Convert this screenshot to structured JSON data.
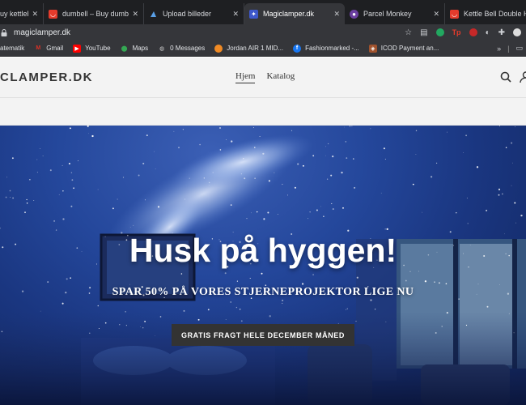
{
  "browser": {
    "tabs": [
      {
        "title": "uy kettleb",
        "favicon": "aliexpress-icon",
        "color": "#e53b2c"
      },
      {
        "title": "dumbell – Buy dumbell",
        "favicon": "aliexpress-icon",
        "color": "#e53b2c"
      },
      {
        "title": "Upload billeder",
        "favicon": "upload-icon",
        "color": "#5aa0e8"
      },
      {
        "title": "Magiclamper.dk",
        "favicon": "magiclamper-icon",
        "color": "#3d57c9"
      },
      {
        "title": "Parcel Monkey",
        "favicon": "monkey-icon",
        "color": "#6b3fa0"
      },
      {
        "title": "Kettle Bell Double Hand",
        "favicon": "aliexpress-icon",
        "color": "#e53b2c"
      }
    ],
    "url": "magiclamper.dk",
    "bookmarks": [
      {
        "label": "atematik",
        "icon": "page-icon",
        "color": "#555"
      },
      {
        "label": "Gmail",
        "icon": "gmail-icon",
        "color": "#d93025"
      },
      {
        "label": "YouTube",
        "icon": "youtube-icon",
        "color": "#ff0000"
      },
      {
        "label": "Maps",
        "icon": "maps-icon",
        "color": "#34a853"
      },
      {
        "label": "0 Messages",
        "icon": "globe-icon",
        "color": "#888"
      },
      {
        "label": "Jordan AIR 1 MID...",
        "icon": "bookmark-orange-icon",
        "color": "#f08a24"
      },
      {
        "label": "Fashionmarked -...",
        "icon": "facebook-icon",
        "color": "#1877f2"
      },
      {
        "label": "ICOD Payment an...",
        "icon": "icod-icon",
        "color": "#a0522d"
      }
    ],
    "more": "»"
  },
  "store": {
    "logo": "CLAMPER.DK",
    "nav": [
      {
        "label": "Hjem",
        "active": true
      },
      {
        "label": "Katalog",
        "active": false
      }
    ]
  },
  "hero": {
    "title": "Husk på hyggen!",
    "subtitle": "SPAR 50% PÅ VORES STJERNEPROJEKTOR LIGE NU",
    "button": "GRATIS FRAGT HELE DECEMBER MÅNED"
  }
}
